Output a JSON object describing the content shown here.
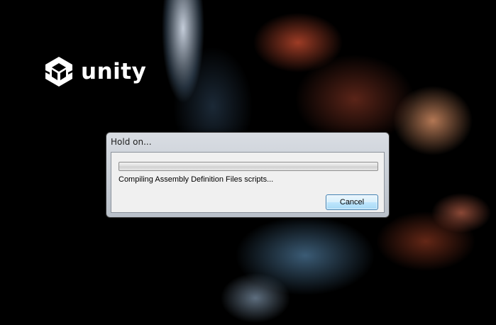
{
  "brand": {
    "logo_icon": "unity-cube-icon",
    "wordmark": "unity"
  },
  "dialog": {
    "title": "Hold on...",
    "progress_fraction": 0.0,
    "status": "Compiling Assembly Definition Files scripts...",
    "cancel_label": "Cancel"
  },
  "colors": {
    "background": "#000000",
    "button_border": "#3c7fb1",
    "progress_fill": "#3fbf3f"
  }
}
